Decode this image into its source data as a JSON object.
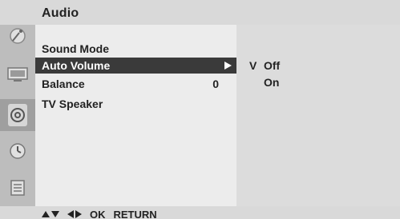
{
  "header": {
    "title": "Audio"
  },
  "sidebar": {
    "icons": [
      {
        "name": "satellite-dish-icon"
      },
      {
        "name": "picture-monitor-icon"
      },
      {
        "name": "audio-speaker-icon",
        "active": true
      },
      {
        "name": "clock-time-icon"
      },
      {
        "name": "option-settings-icon"
      }
    ]
  },
  "menu": {
    "items": [
      {
        "label": "Sound Mode",
        "value": "",
        "selected": false
      },
      {
        "label": "Auto Volume",
        "value": "",
        "selected": true
      },
      {
        "label": "Balance",
        "value": "0",
        "selected": false
      },
      {
        "label": "TV Speaker",
        "value": "",
        "selected": false
      }
    ]
  },
  "submenu": {
    "check_mark": "V",
    "items": [
      {
        "label": "Off",
        "checked": true
      },
      {
        "label": "On",
        "checked": false
      }
    ]
  },
  "footer": {
    "ok_label": "OK",
    "return_label": "RETURN"
  },
  "colors": {
    "header_bg": "#d9d9d9",
    "sidebar_bg": "#bdbdbd",
    "main_bg": "#ececec",
    "sub_bg": "#dcdcdc",
    "selection_bg": "#3a3a3a"
  }
}
